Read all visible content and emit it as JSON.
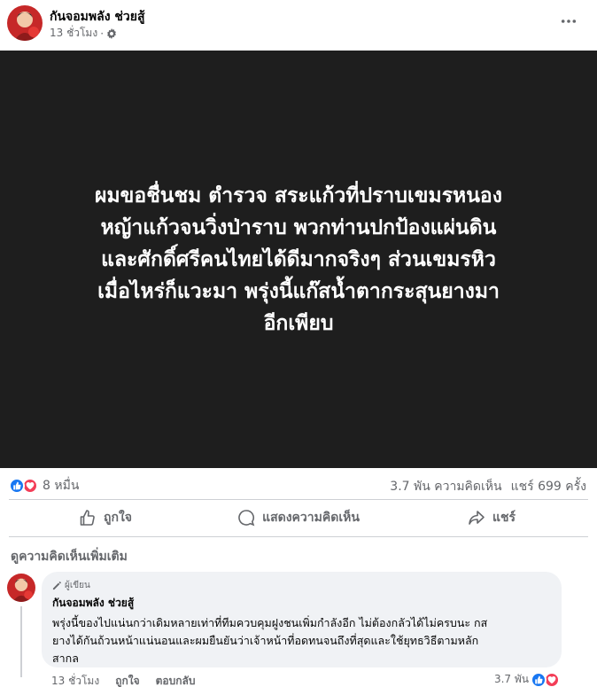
{
  "post": {
    "author": "กันจอมพลัง ช่วยสู้",
    "time": "13 ชั่วโมง",
    "privacy_icon": "gear-icon",
    "image_text_lines": [
      "ผมขอชื่นชม ตำรวจ สระแก้วที่ปราบเขมรหนอง",
      "หญ้าแก้วจนวิ่งป่าราบ พวกท่านปกป้องแผ่นดิน",
      "และศักดิ์ศรีคนไทยได้ดีมากจริงๆ ส่วนเขมรหิว",
      "เมื่อไหร่ก็แวะมา พรุ่งนี้แก๊สน้ำตากระสุนยางมา",
      "อีกเพียบ"
    ],
    "image_bg": "#1e1e1e"
  },
  "stats": {
    "reaction_count": "8 หมื่น",
    "comments": "3.7 พัน ความคิดเห็น",
    "shares": "แชร์ 699 ครั้ง"
  },
  "actions": {
    "like": "ถูกใจ",
    "comment": "แสดงความคิดเห็น",
    "share": "แชร์"
  },
  "more_comments": "ดูความคิดเห็นเพิ่มเติม",
  "comment": {
    "badge": "ผู้เขียน",
    "author": "กันจอมพลัง ช่วยสู้",
    "text_lines": [
      "พรุ่งนี้ของไปแน่นกว่าเดิมหลายเท่าที่ทีมควบคุมฝูงชนเพิ่มกำลังอีก ไม่ต้องกลัวได้ไม่ครบนะ กส",
      "ยางได้กันถ้วนหน้าแน่นอนและผมยืนยันว่าเจ้าหน้าที่อดทนจนถึงที่สุดและใช้ยุทธวิธีตามหลัก",
      "สากล"
    ],
    "time": "13 ชั่วโมง",
    "like": "ถูกใจ",
    "reply": "ตอบกลับ",
    "reaction_count": "3.7 พัน"
  },
  "colors": {
    "like_blue": "#1877f2",
    "love_red": "#f33e58",
    "secondary_text": "#65676b"
  }
}
